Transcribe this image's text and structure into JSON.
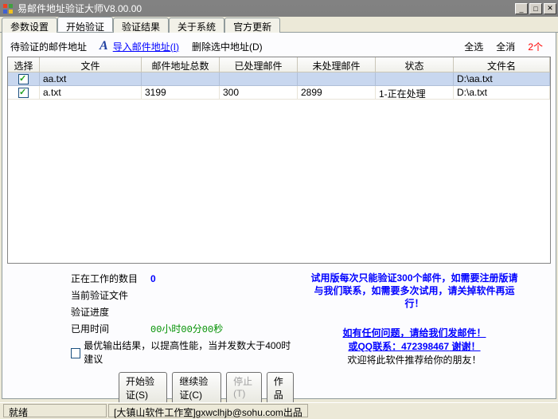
{
  "window": {
    "title": "易邮件地址验证大师V8.00.00"
  },
  "tabs": [
    {
      "label": "参数设置"
    },
    {
      "label": "开始验证"
    },
    {
      "label": "验证结果"
    },
    {
      "label": "关于系统"
    },
    {
      "label": "官方更新"
    }
  ],
  "toolbar": {
    "pending_label": "待验证的邮件地址",
    "import_label": "导入邮件地址(I)",
    "delete_label": "删除选中地址(D)",
    "select_all": "全选",
    "deselect_all": "全消",
    "count": "2个"
  },
  "grid": {
    "headers": {
      "select": "选择",
      "file": "文件",
      "total": "邮件地址总数",
      "processed": "已处理邮件",
      "unprocessed": "未处理邮件",
      "status": "状态",
      "filename": "文件名"
    },
    "rows": [
      {
        "checked": true,
        "file": "aa.txt",
        "total": "",
        "processed": "",
        "unprocessed": "",
        "status": "",
        "filename": "D:\\aa.txt",
        "active": true
      },
      {
        "checked": true,
        "file": "a.txt",
        "total": "3199",
        "processed": "300",
        "unprocessed": "2899",
        "status": "1-正在处理",
        "filename": "D:\\a.txt",
        "active": false
      }
    ]
  },
  "status": {
    "working_label": "正在工作的数目",
    "working_val": "0",
    "current_file_label": "当前验证文件",
    "progress_label": "验证进度",
    "time_label": "已用时间",
    "time_val": "00小时00分00秒",
    "optimize_label": "最优输出结果，以提高性能，当并发数大于400时建议",
    "trial_msg": "试用版每次只能验证300个邮件，如需要注册版请与我们联系，如需要多次试用，请关掉软件再运行！",
    "contact1": "如有任何问题，请给我们发邮件！",
    "contact2_pre": "或QQ联系：",
    "contact2_num": "472398467",
    "contact2_thx": "   谢谢！",
    "recommend": "欢迎将此软件推荐给你的朋友！"
  },
  "buttons": {
    "start": "开始验证(S)",
    "continue": "继续验证(C)",
    "stop": "停止(T)",
    "work": "作品"
  },
  "statusbar": {
    "ready": "就绪",
    "credit": "[大镇山软件工作室]gxwclhjb@sohu.com出品"
  }
}
